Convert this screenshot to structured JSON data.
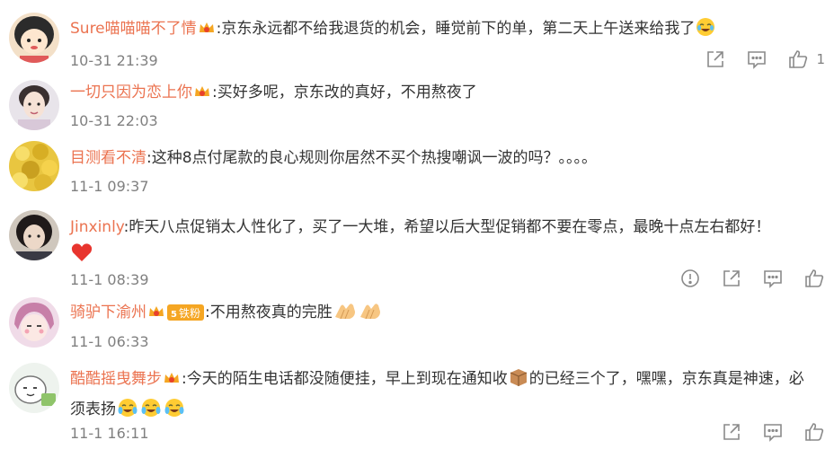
{
  "comments": [
    {
      "user": "Sure喵喵喵不了情",
      "text": ":京东永远都不给我退货的机会，睡觉前下的单，第二天上午送来给我了",
      "time": "10-31 21:39",
      "likes": "1",
      "badge": "crown-vip",
      "emoji": [
        "laugh-cry-emoji"
      ]
    },
    {
      "user": "一切只因为恋上你",
      "text": ":买好多呢，京东改的真好，不用熬夜了",
      "time": "10-31 22:03",
      "badge": "crown-vip"
    },
    {
      "user": "目测看不清",
      "text": ":这种8点付尾款的良心规则你居然不买个热搜嘲讽一波的吗？。。。。",
      "time": "11-1 09:37"
    },
    {
      "user": "Jinxinly",
      "text": ":昨天八点促销太人性化了，买了一大堆，希望以后大型促销都不要在零点，最晚十点左右都好！",
      "time": "11-1 08:39",
      "emoji": [
        "heart-emoji"
      ]
    },
    {
      "user": "骑驴下渝州",
      "text": ":不用熬夜真的完胜",
      "time": "11-1 06:33",
      "badge": "crown-vip",
      "fan_badge": "铁粉",
      "fan_level": "5",
      "emoji": [
        "clap-emoji",
        "clap-emoji"
      ]
    },
    {
      "user": "酷酷摇曳舞步",
      "text_a": ":今天的陌生电话都没随便挂，早上到现在通知收",
      "text_b": "的已经三个了，嘿嘿，京东真是神速，必须表扬",
      "time": "11-1 16:11",
      "badge": "crown-vip",
      "emoji": [
        "package-emoji",
        "cry-laugh-emoji",
        "cry-laugh-emoji",
        "cry-laugh-emoji"
      ]
    }
  ],
  "colors": {
    "username": "#eb7350",
    "timestamp": "#808080",
    "icon": "#8a8a8a"
  }
}
